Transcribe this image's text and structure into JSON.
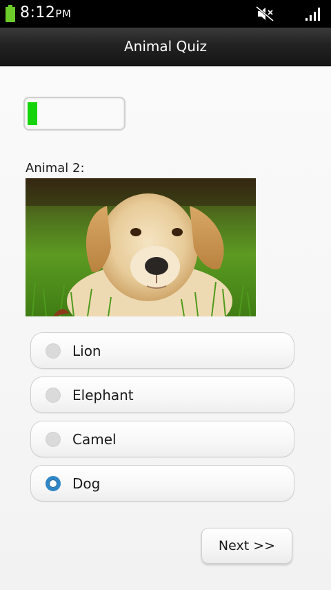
{
  "status_bar": {
    "time": "8:12",
    "ampm": "PM",
    "battery_color": "#6ccb2a",
    "icons": [
      "battery-icon",
      "mute-icon",
      "signal-icon"
    ]
  },
  "app": {
    "title": "Animal Quiz"
  },
  "progress": {
    "value_fraction": 0.1,
    "fill_color": "#16d40c"
  },
  "question": {
    "label": "Animal 2:",
    "image": "puppy-photo"
  },
  "options": [
    {
      "label": "Lion",
      "selected": false
    },
    {
      "label": "Elephant",
      "selected": false
    },
    {
      "label": "Camel",
      "selected": false
    },
    {
      "label": "Dog",
      "selected": true
    }
  ],
  "navigation": {
    "next_label": "Next >>"
  },
  "colors": {
    "radio_selected": "#2f86c7",
    "actionbar": "#222222"
  }
}
